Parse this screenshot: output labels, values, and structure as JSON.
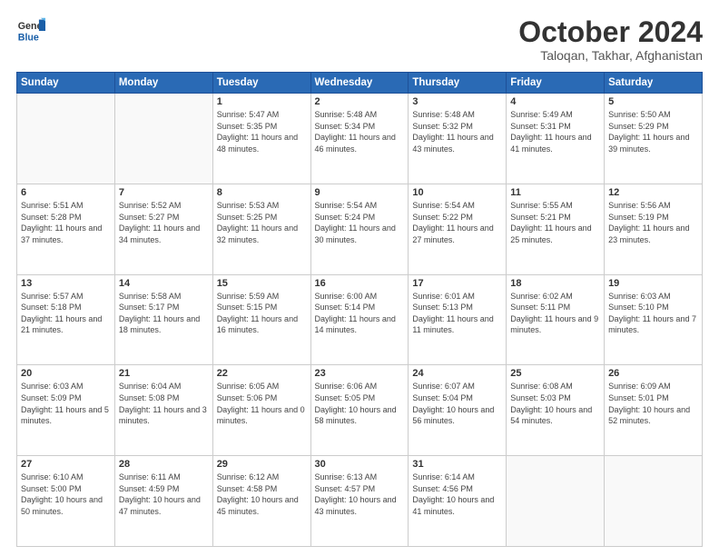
{
  "header": {
    "logo_line1": "General",
    "logo_line2": "Blue",
    "month": "October 2024",
    "location": "Taloqan, Takhar, Afghanistan"
  },
  "weekdays": [
    "Sunday",
    "Monday",
    "Tuesday",
    "Wednesday",
    "Thursday",
    "Friday",
    "Saturday"
  ],
  "weeks": [
    [
      {
        "day": "",
        "empty": true
      },
      {
        "day": "",
        "empty": true
      },
      {
        "day": "1",
        "sunrise": "Sunrise: 5:47 AM",
        "sunset": "Sunset: 5:35 PM",
        "daylight": "Daylight: 11 hours and 48 minutes."
      },
      {
        "day": "2",
        "sunrise": "Sunrise: 5:48 AM",
        "sunset": "Sunset: 5:34 PM",
        "daylight": "Daylight: 11 hours and 46 minutes."
      },
      {
        "day": "3",
        "sunrise": "Sunrise: 5:48 AM",
        "sunset": "Sunset: 5:32 PM",
        "daylight": "Daylight: 11 hours and 43 minutes."
      },
      {
        "day": "4",
        "sunrise": "Sunrise: 5:49 AM",
        "sunset": "Sunset: 5:31 PM",
        "daylight": "Daylight: 11 hours and 41 minutes."
      },
      {
        "day": "5",
        "sunrise": "Sunrise: 5:50 AM",
        "sunset": "Sunset: 5:29 PM",
        "daylight": "Daylight: 11 hours and 39 minutes."
      }
    ],
    [
      {
        "day": "6",
        "sunrise": "Sunrise: 5:51 AM",
        "sunset": "Sunset: 5:28 PM",
        "daylight": "Daylight: 11 hours and 37 minutes."
      },
      {
        "day": "7",
        "sunrise": "Sunrise: 5:52 AM",
        "sunset": "Sunset: 5:27 PM",
        "daylight": "Daylight: 11 hours and 34 minutes."
      },
      {
        "day": "8",
        "sunrise": "Sunrise: 5:53 AM",
        "sunset": "Sunset: 5:25 PM",
        "daylight": "Daylight: 11 hours and 32 minutes."
      },
      {
        "day": "9",
        "sunrise": "Sunrise: 5:54 AM",
        "sunset": "Sunset: 5:24 PM",
        "daylight": "Daylight: 11 hours and 30 minutes."
      },
      {
        "day": "10",
        "sunrise": "Sunrise: 5:54 AM",
        "sunset": "Sunset: 5:22 PM",
        "daylight": "Daylight: 11 hours and 27 minutes."
      },
      {
        "day": "11",
        "sunrise": "Sunrise: 5:55 AM",
        "sunset": "Sunset: 5:21 PM",
        "daylight": "Daylight: 11 hours and 25 minutes."
      },
      {
        "day": "12",
        "sunrise": "Sunrise: 5:56 AM",
        "sunset": "Sunset: 5:19 PM",
        "daylight": "Daylight: 11 hours and 23 minutes."
      }
    ],
    [
      {
        "day": "13",
        "sunrise": "Sunrise: 5:57 AM",
        "sunset": "Sunset: 5:18 PM",
        "daylight": "Daylight: 11 hours and 21 minutes."
      },
      {
        "day": "14",
        "sunrise": "Sunrise: 5:58 AM",
        "sunset": "Sunset: 5:17 PM",
        "daylight": "Daylight: 11 hours and 18 minutes."
      },
      {
        "day": "15",
        "sunrise": "Sunrise: 5:59 AM",
        "sunset": "Sunset: 5:15 PM",
        "daylight": "Daylight: 11 hours and 16 minutes."
      },
      {
        "day": "16",
        "sunrise": "Sunrise: 6:00 AM",
        "sunset": "Sunset: 5:14 PM",
        "daylight": "Daylight: 11 hours and 14 minutes."
      },
      {
        "day": "17",
        "sunrise": "Sunrise: 6:01 AM",
        "sunset": "Sunset: 5:13 PM",
        "daylight": "Daylight: 11 hours and 11 minutes."
      },
      {
        "day": "18",
        "sunrise": "Sunrise: 6:02 AM",
        "sunset": "Sunset: 5:11 PM",
        "daylight": "Daylight: 11 hours and 9 minutes."
      },
      {
        "day": "19",
        "sunrise": "Sunrise: 6:03 AM",
        "sunset": "Sunset: 5:10 PM",
        "daylight": "Daylight: 11 hours and 7 minutes."
      }
    ],
    [
      {
        "day": "20",
        "sunrise": "Sunrise: 6:03 AM",
        "sunset": "Sunset: 5:09 PM",
        "daylight": "Daylight: 11 hours and 5 minutes."
      },
      {
        "day": "21",
        "sunrise": "Sunrise: 6:04 AM",
        "sunset": "Sunset: 5:08 PM",
        "daylight": "Daylight: 11 hours and 3 minutes."
      },
      {
        "day": "22",
        "sunrise": "Sunrise: 6:05 AM",
        "sunset": "Sunset: 5:06 PM",
        "daylight": "Daylight: 11 hours and 0 minutes."
      },
      {
        "day": "23",
        "sunrise": "Sunrise: 6:06 AM",
        "sunset": "Sunset: 5:05 PM",
        "daylight": "Daylight: 10 hours and 58 minutes."
      },
      {
        "day": "24",
        "sunrise": "Sunrise: 6:07 AM",
        "sunset": "Sunset: 5:04 PM",
        "daylight": "Daylight: 10 hours and 56 minutes."
      },
      {
        "day": "25",
        "sunrise": "Sunrise: 6:08 AM",
        "sunset": "Sunset: 5:03 PM",
        "daylight": "Daylight: 10 hours and 54 minutes."
      },
      {
        "day": "26",
        "sunrise": "Sunrise: 6:09 AM",
        "sunset": "Sunset: 5:01 PM",
        "daylight": "Daylight: 10 hours and 52 minutes."
      }
    ],
    [
      {
        "day": "27",
        "sunrise": "Sunrise: 6:10 AM",
        "sunset": "Sunset: 5:00 PM",
        "daylight": "Daylight: 10 hours and 50 minutes."
      },
      {
        "day": "28",
        "sunrise": "Sunrise: 6:11 AM",
        "sunset": "Sunset: 4:59 PM",
        "daylight": "Daylight: 10 hours and 47 minutes."
      },
      {
        "day": "29",
        "sunrise": "Sunrise: 6:12 AM",
        "sunset": "Sunset: 4:58 PM",
        "daylight": "Daylight: 10 hours and 45 minutes."
      },
      {
        "day": "30",
        "sunrise": "Sunrise: 6:13 AM",
        "sunset": "Sunset: 4:57 PM",
        "daylight": "Daylight: 10 hours and 43 minutes."
      },
      {
        "day": "31",
        "sunrise": "Sunrise: 6:14 AM",
        "sunset": "Sunset: 4:56 PM",
        "daylight": "Daylight: 10 hours and 41 minutes."
      },
      {
        "day": "",
        "empty": true
      },
      {
        "day": "",
        "empty": true
      }
    ]
  ]
}
